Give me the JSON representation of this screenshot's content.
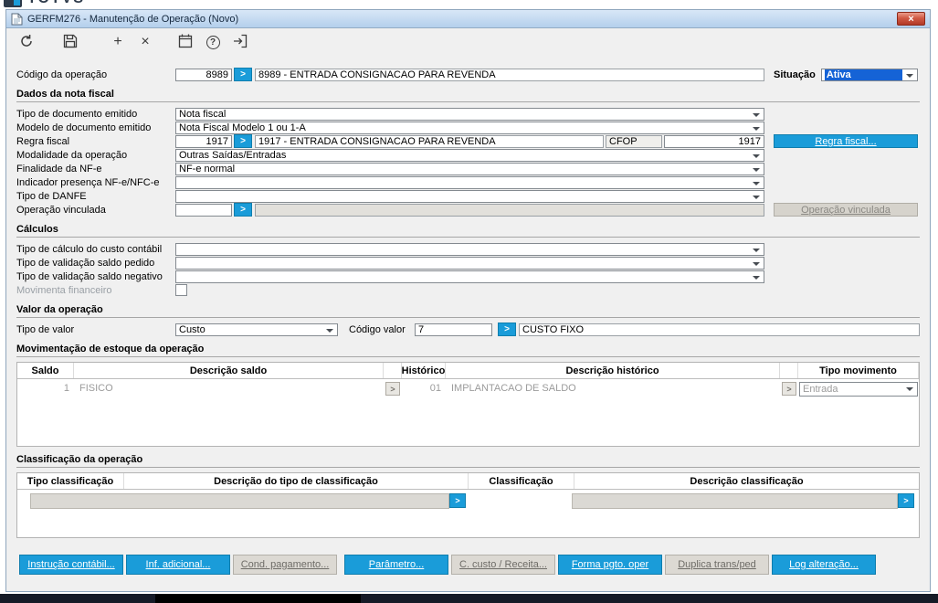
{
  "logo": {
    "text": "TOTVS"
  },
  "colors": {
    "accent_blue": "#1a9cd9",
    "titlebar_blue": "#b4cfec",
    "selection_blue": "#1563d6"
  },
  "window": {
    "title": "GERFM276 - Manutenção de Operação (Novo)",
    "close_glyph": "×"
  },
  "ui": {
    "lookup_glyph": ">",
    "help_glyph": "?",
    "add_glyph": "+",
    "delete_glyph": "×"
  },
  "toolbar": {
    "icons": [
      "undo-icon",
      "save-icon",
      "add-icon",
      "delete-icon",
      "calendar-icon",
      "help-icon",
      "exit-icon"
    ]
  },
  "operation": {
    "label": "Código da operação",
    "code": "8989",
    "description": "8989 - ENTRADA CONSIGNACAO PARA REVENDA",
    "situacao": {
      "label": "Situação",
      "value": "Ativa"
    }
  },
  "nota_fiscal": {
    "title": "Dados da nota fiscal",
    "tipo_documento": {
      "label": "Tipo de documento emitido",
      "value": "Nota fiscal"
    },
    "modelo_documento": {
      "label": "Modelo de documento emitido",
      "value": "Nota Fiscal Modelo 1 ou 1-A"
    },
    "regra_fiscal": {
      "label": "Regra fiscal",
      "code": "1917",
      "description": "1917 - ENTRADA CONSIGNACAO PARA REVENDA",
      "cfop_label": "CFOP",
      "cfop_value": "1917",
      "button_label": "Regra fiscal..."
    },
    "modalidade": {
      "label": "Modalidade da operação",
      "value": "Outras Saídas/Entradas"
    },
    "finalidade": {
      "label": "Finalidade da NF-e",
      "value": "NF-e normal"
    },
    "indicador_presenca": {
      "label": "Indicador presença NF-e/NFC-e",
      "value": ""
    },
    "tipo_danfe": {
      "label": "Tipo de DANFE",
      "value": ""
    },
    "operacao_vinculada": {
      "label": "Operação vinculada",
      "code": "",
      "description": "",
      "button_label": "Operação vinculada"
    }
  },
  "calculos": {
    "title": "Cálculos",
    "custo_contabil": {
      "label": "Tipo de cálculo do custo contábil",
      "value": ""
    },
    "saldo_pedido": {
      "label": "Tipo de validação saldo pedido",
      "value": ""
    },
    "saldo_negativo": {
      "label": "Tipo de validação saldo negativo",
      "value": ""
    },
    "movimenta_financeiro": {
      "label": "Movimenta financeiro",
      "checked": false
    }
  },
  "valor_operacao": {
    "title": "Valor da operação",
    "tipo_valor": {
      "label": "Tipo de valor",
      "value": "Custo"
    },
    "codigo_valor": {
      "label": "Código valor",
      "code": "7",
      "description": "CUSTO FIXO"
    }
  },
  "movimentacao": {
    "title": "Movimentação de estoque da operação",
    "headers": {
      "saldo": "Saldo",
      "descricao_saldo": "Descrição saldo",
      "historico": "Histórico",
      "descricao_historico": "Descrição histórico",
      "tipo_movimento": "Tipo movimento"
    },
    "rows": [
      {
        "saldo": "1",
        "descricao_saldo": "FISICO",
        "historico": "01",
        "descricao_historico": "IMPLANTACAO DE SALDO",
        "tipo_movimento": "Entrada"
      }
    ]
  },
  "classificacao": {
    "title": "Classificação da operação",
    "headers": {
      "tipo": "Tipo classificação",
      "descricao_tipo": "Descrição do tipo de classificação",
      "classificacao": "Classificação",
      "descricao_classificacao": "Descrição classificação"
    },
    "rows": [
      {
        "descricao_tipo": "",
        "descricao_classificacao": ""
      }
    ]
  },
  "footer_buttons": [
    {
      "label": "Instrução contábil...",
      "enabled": true
    },
    {
      "label": "Inf. adicional...",
      "enabled": true
    },
    {
      "label": "Cond. pagamento...",
      "enabled": false
    },
    {
      "label": "Parâmetro...",
      "enabled": true
    },
    {
      "label": "C. custo / Receita...",
      "enabled": false
    },
    {
      "label": "Forma pgto. oper",
      "enabled": true
    },
    {
      "label": "Duplica trans/ped",
      "enabled": false
    },
    {
      "label": "Log alteração...",
      "enabled": true
    }
  ]
}
